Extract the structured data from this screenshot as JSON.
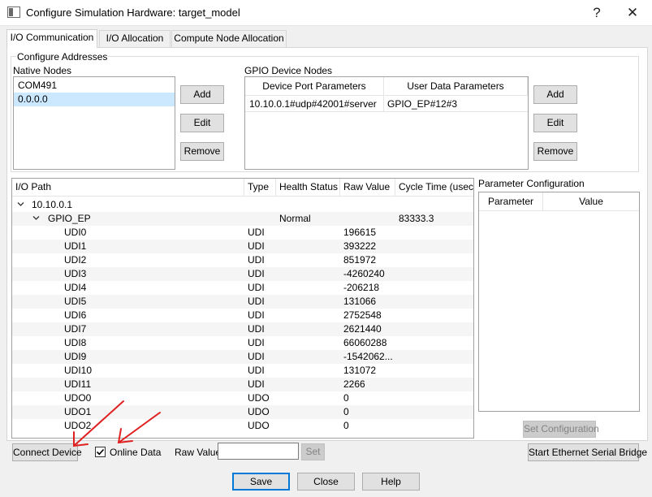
{
  "window": {
    "title": "Configure Simulation Hardware: target_model",
    "help_glyph": "?",
    "close_glyph": "✕"
  },
  "tabs": [
    {
      "label": "I/O Communication",
      "active": true
    },
    {
      "label": "I/O Allocation",
      "active": false
    },
    {
      "label": "Compute Node Allocation",
      "active": false
    }
  ],
  "configure_addresses": {
    "title": "Configure Addresses",
    "native_nodes": {
      "label": "Native Nodes",
      "items": [
        "COM491",
        "0.0.0.0"
      ],
      "selected_index": 1,
      "buttons": {
        "add": "Add",
        "edit": "Edit",
        "remove": "Remove"
      }
    },
    "gpio_nodes": {
      "label": "GPIO Device Nodes",
      "columns": [
        "Device Port Parameters",
        "User Data Parameters"
      ],
      "rows": [
        [
          "10.10.0.1#udp#42001#server",
          "GPIO_EP#12#3"
        ]
      ],
      "buttons": {
        "add": "Add",
        "edit": "Edit",
        "remove": "Remove"
      }
    }
  },
  "io_tree": {
    "columns": [
      "I/O Path",
      "Type",
      "Health Status",
      "Raw Value",
      "Cycle Time (usec"
    ],
    "root": {
      "path": "10.10.0.1"
    },
    "device": {
      "path": "GPIO_EP",
      "health": "Normal",
      "cycle": "83333.3"
    },
    "rows": [
      {
        "path": "UDI0",
        "type": "UDI",
        "raw": "196615"
      },
      {
        "path": "UDI1",
        "type": "UDI",
        "raw": "393222"
      },
      {
        "path": "UDI2",
        "type": "UDI",
        "raw": "851972"
      },
      {
        "path": "UDI3",
        "type": "UDI",
        "raw": "-4260240"
      },
      {
        "path": "UDI4",
        "type": "UDI",
        "raw": "-206218"
      },
      {
        "path": "UDI5",
        "type": "UDI",
        "raw": "131066"
      },
      {
        "path": "UDI6",
        "type": "UDI",
        "raw": "2752548"
      },
      {
        "path": "UDI7",
        "type": "UDI",
        "raw": "2621440"
      },
      {
        "path": "UDI8",
        "type": "UDI",
        "raw": "66060288"
      },
      {
        "path": "UDI9",
        "type": "UDI",
        "raw": "-1542062..."
      },
      {
        "path": "UDI10",
        "type": "UDI",
        "raw": "131072"
      },
      {
        "path": "UDI11",
        "type": "UDI",
        "raw": "2266"
      },
      {
        "path": "UDO0",
        "type": "UDO",
        "raw": "0"
      },
      {
        "path": "UDO1",
        "type": "UDO",
        "raw": "0"
      },
      {
        "path": "UDO2",
        "type": "UDO",
        "raw": "0"
      }
    ]
  },
  "param_config": {
    "title": "Parameter Configuration",
    "columns": [
      "Parameter",
      "Value"
    ],
    "set_button": "Set Configuration"
  },
  "bottom_controls": {
    "connect_device": "Connect Device",
    "online_data_label": "Online Data",
    "online_data_checked": true,
    "raw_value_label": "Raw Value",
    "raw_value_input": "",
    "set_button": "Set",
    "bridge_button": "Start Ethernet Serial Bridge"
  },
  "dialog_buttons": {
    "save": "Save",
    "close": "Close",
    "help": "Help"
  },
  "icons": {
    "app": "window-app-icon",
    "expand": "chevron-down-icon",
    "annotation": "red-arrow-icon"
  },
  "colors": {
    "selection": "#cce8ff",
    "annotation_arrow": "#e02020",
    "primary_border": "#0078d7"
  }
}
